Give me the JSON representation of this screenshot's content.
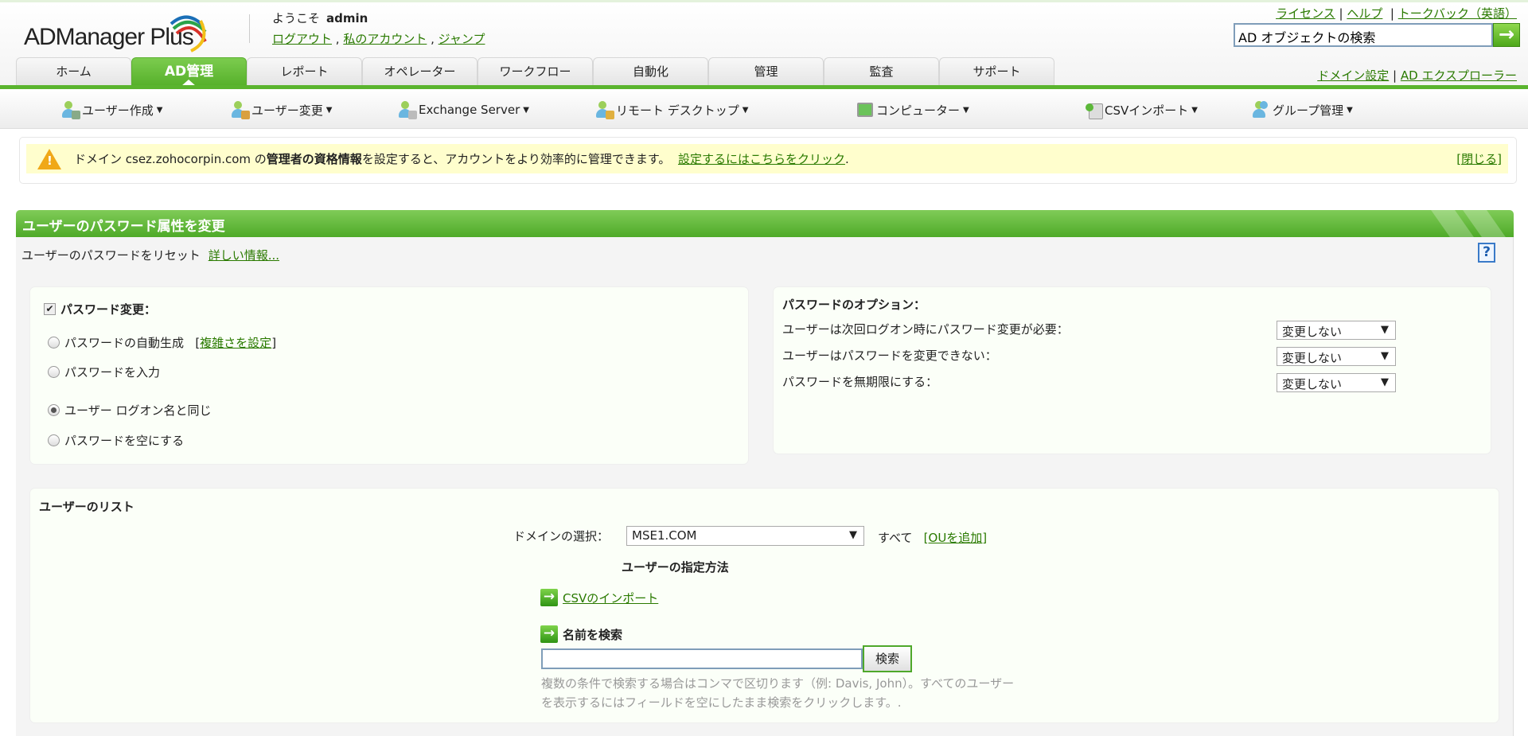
{
  "header": {
    "logo": "ADManager Plus",
    "welcome": "ようこそ",
    "user": "admin",
    "user_links": [
      "ログアウト",
      "私のアカウント",
      "ジャンプ"
    ],
    "top_links": [
      "ライセンス",
      "ヘルプ",
      "トークバック（英語）"
    ],
    "search_placeholder": "AD オブジェクトの検索",
    "right_links": [
      "ドメイン設定",
      "AD エクスプローラー"
    ]
  },
  "tabs": [
    "ホーム",
    "AD管理",
    "レポート",
    "オペレーター",
    "ワークフロー",
    "自動化",
    "管理",
    "監査",
    "サポート"
  ],
  "active_tab": "AD管理",
  "submenu": [
    "ユーザー作成",
    "ユーザー変更",
    "Exchange Server",
    "リモート デスクトップ",
    "コンピューター",
    "CSVインポート",
    "グループ管理"
  ],
  "alert": {
    "pre": "ドメイン csez.zohocorpin.com の",
    "bold": "管理者の資格情報",
    "post": "を設定すると、アカウントをより効率的に管理できます。",
    "link": "設定するにはこちらをクリック",
    "close": "[閉じる]"
  },
  "panel": {
    "title": "ユーザーのパスワード属性を変更",
    "subtitle": "ユーザーのパスワードをリセット",
    "more": "詳しい情報...",
    "help": "?"
  },
  "password": {
    "label": "パスワード変更：",
    "checked": true,
    "options": [
      "パスワードの自動生成",
      "パスワードを入力",
      "ユーザー ログオン名と同じ",
      "パスワードを空にする"
    ],
    "complexity_link": "複雑さを設定",
    "selected": "ユーザー ログオン名と同じ"
  },
  "options": {
    "title": "パスワードのオプション：",
    "rows": [
      {
        "label": "ユーザーは次回ログオン時にパスワード変更が必要：",
        "value": "変更しない"
      },
      {
        "label": "ユーザーはパスワードを変更できない：",
        "value": "変更しない"
      },
      {
        "label": "パスワードを無期限にする：",
        "value": "変更しない"
      }
    ]
  },
  "userlist": {
    "title": "ユーザーのリスト",
    "domain_label": "ドメインの選択：",
    "domain": "MSE1.COM",
    "all": "すべて",
    "add_ou": "[OUを追加]",
    "method_title": "ユーザーの指定方法",
    "csv_import": "CSVのインポート",
    "search_name": "名前を検索",
    "search_value": "",
    "search_btn": "検索",
    "hint": "複数の条件で検索する場合はコンマで区切ります（例: Davis, John）。すべてのユーザーを表示するにはフィールドを空にしたまま検索をクリックします。."
  }
}
